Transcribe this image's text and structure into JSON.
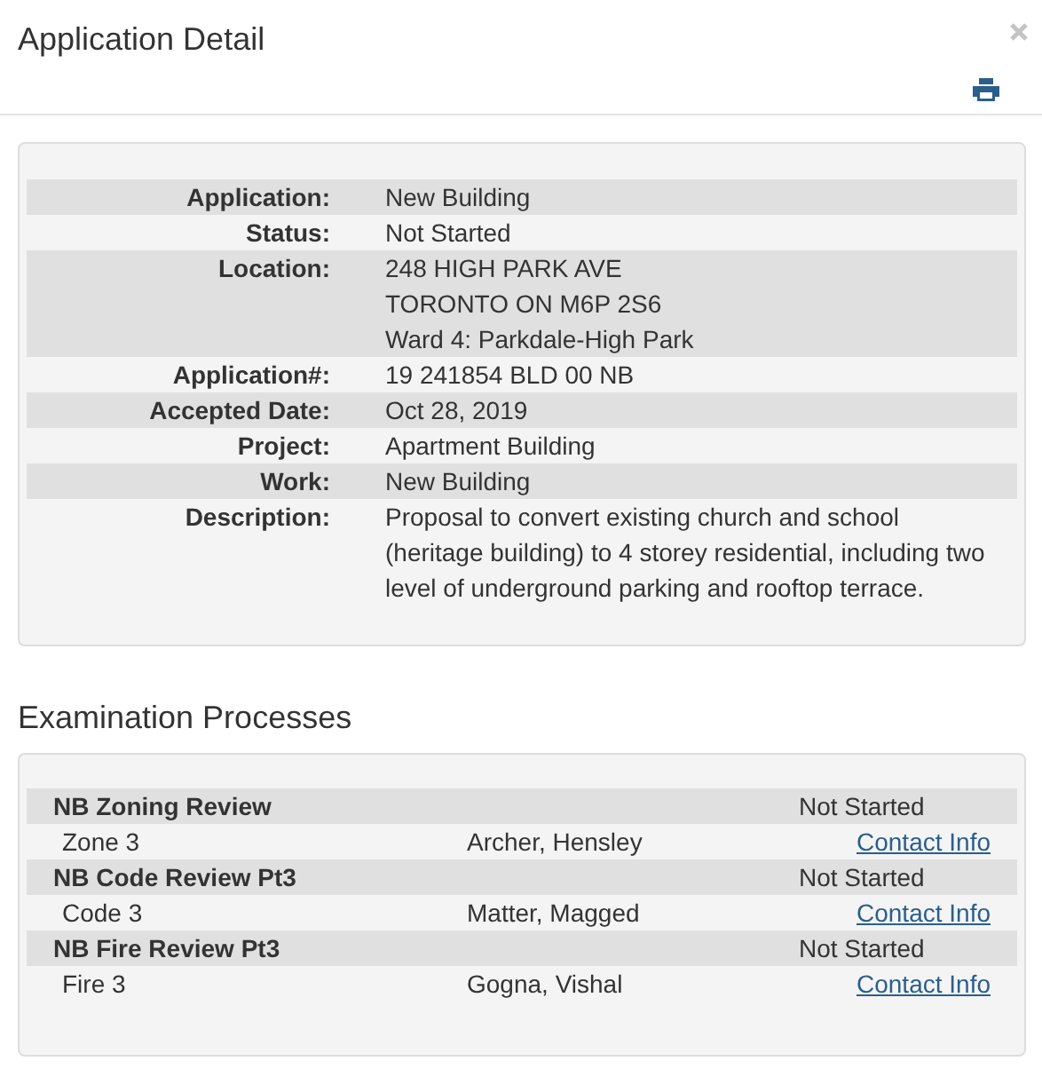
{
  "window": {
    "title": "Application Detail"
  },
  "details": [
    {
      "label": "Application:",
      "lines": [
        "New Building"
      ]
    },
    {
      "label": "Status:",
      "lines": [
        "Not Started"
      ]
    },
    {
      "label": "Location:",
      "lines": [
        "248 HIGH PARK AVE",
        "TORONTO ON M6P 2S6",
        "Ward 4: Parkdale-High Park"
      ]
    },
    {
      "label": "Application#:",
      "lines": [
        "19 241854 BLD 00 NB"
      ]
    },
    {
      "label": "Accepted Date:",
      "lines": [
        "Oct 28, 2019"
      ]
    },
    {
      "label": "Project:",
      "lines": [
        "Apartment Building"
      ]
    },
    {
      "label": "Work:",
      "lines": [
        "New Building"
      ]
    },
    {
      "label": "Description:",
      "lines": [
        "Proposal to convert existing church and school (heritage building) to 4 storey residential, including two level of underground parking and rooftop terrace."
      ]
    }
  ],
  "examination": {
    "title": "Examination Processes",
    "processes": [
      {
        "name": "NB Zoning Review",
        "status": "Not Started",
        "area": "Zone 3",
        "examiner": "Archer, Hensley",
        "link": "Contact Info"
      },
      {
        "name": "NB Code Review Pt3",
        "status": "Not Started",
        "area": "Code 3",
        "examiner": "Matter, Magged",
        "link": "Contact Info"
      },
      {
        "name": "NB Fire Review Pt3",
        "status": "Not Started",
        "area": "Fire 3",
        "examiner": "Gogna, Vishal",
        "link": "Contact Info"
      }
    ]
  }
}
